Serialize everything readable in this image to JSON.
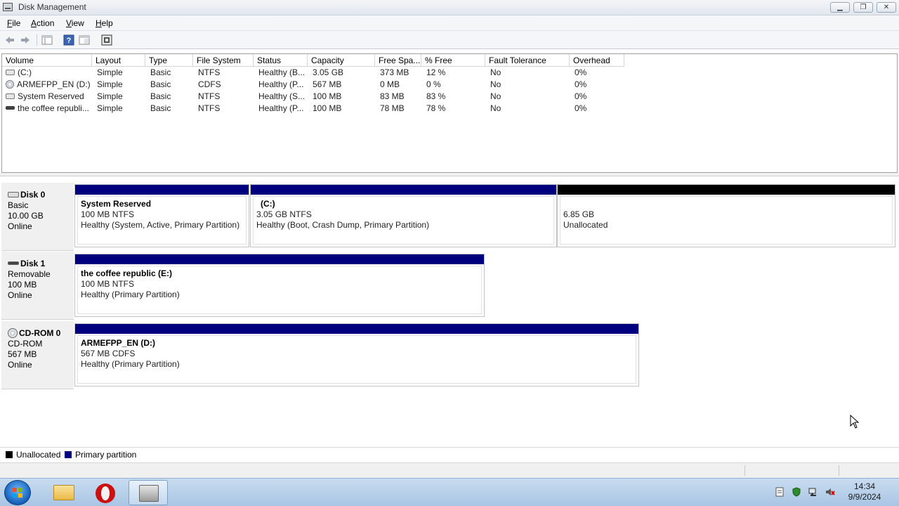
{
  "window": {
    "title": "Disk Management"
  },
  "menu": [
    {
      "label": "File",
      "mnemonic": "F",
      "rest": "ile"
    },
    {
      "label": "Action",
      "mnemonic": "A",
      "rest": "ction"
    },
    {
      "label": "View",
      "mnemonic": "V",
      "rest": "iew"
    },
    {
      "label": "Help",
      "mnemonic": "H",
      "rest": "elp"
    }
  ],
  "toolbar": {
    "icons": [
      "back-arrow-icon",
      "forward-arrow-icon",
      "show-hide-tree-icon",
      "help-icon",
      "properties-icon",
      "disk-refresh-icon"
    ]
  },
  "volume_list": {
    "columns": [
      "Volume",
      "Layout",
      "Type",
      "File System",
      "Status",
      "Capacity",
      "Free Spa...",
      "% Free",
      "Fault Tolerance",
      "Overhead"
    ],
    "rows": [
      {
        "icon": "hard-drive-icon",
        "volume": "(C:)",
        "layout": "Simple",
        "type": "Basic",
        "fs": "NTFS",
        "status": "Healthy (B...",
        "capacity": "3.05 GB",
        "free": "373 MB",
        "pct": "12 %",
        "fault": "No",
        "overhead": "0%"
      },
      {
        "icon": "cd-drive-icon",
        "volume": "ARMEFPP_EN (D:)",
        "layout": "Simple",
        "type": "Basic",
        "fs": "CDFS",
        "status": "Healthy (P...",
        "capacity": "567 MB",
        "free": "0 MB",
        "pct": "0 %",
        "fault": "No",
        "overhead": "0%"
      },
      {
        "icon": "hard-drive-icon",
        "volume": "System Reserved",
        "layout": "Simple",
        "type": "Basic",
        "fs": "NTFS",
        "status": "Healthy (S...",
        "capacity": "100 MB",
        "free": "83 MB",
        "pct": "83 %",
        "fault": "No",
        "overhead": "0%"
      },
      {
        "icon": "usb-drive-icon",
        "volume": "the coffee republi...",
        "layout": "Simple",
        "type": "Basic",
        "fs": "NTFS",
        "status": "Healthy (P...",
        "capacity": "100 MB",
        "free": "78 MB",
        "pct": "78 %",
        "fault": "No",
        "overhead": "0%"
      }
    ]
  },
  "disks": [
    {
      "name": "Disk 0",
      "kind": "Basic",
      "size": "10.00 GB",
      "state": "Online",
      "partitions": [
        {
          "title": "System Reserved",
          "line2": "100 MB NTFS",
          "line3": "Healthy (System, Active, Primary Partition)",
          "style": "primary"
        },
        {
          "title": "(C:)",
          "line2": "3.05 GB NTFS",
          "line3": "Healthy (Boot, Crash Dump, Primary Partition)",
          "style": "primary"
        },
        {
          "title": "",
          "line2": "6.85 GB",
          "line3": "Unallocated",
          "style": "unallocated"
        }
      ]
    },
    {
      "name": "Disk 1",
      "kind": "Removable",
      "size": "100 MB",
      "state": "Online",
      "partitions": [
        {
          "title": "the coffee republic  (E:)",
          "line2": "100 MB NTFS",
          "line3": "Healthy (Primary Partition)",
          "style": "primary"
        }
      ]
    },
    {
      "name": "CD-ROM 0",
      "kind": "CD-ROM",
      "size": "567 MB",
      "state": "Online",
      "partitions": [
        {
          "title": "ARMEFPP_EN  (D:)",
          "line2": "567 MB CDFS",
          "line3": "Healthy (Primary Partition)",
          "style": "primary"
        }
      ]
    }
  ],
  "legend": [
    {
      "label": "Unallocated",
      "color": "#000000"
    },
    {
      "label": "Primary partition",
      "color": "#00007f"
    }
  ],
  "taskbar": {
    "apps": [
      "windows-explorer-icon",
      "opera-browser-icon",
      "disk-management-icon"
    ],
    "tray": [
      "action-center-icon",
      "security-icon",
      "network-icon",
      "volume-muted-icon"
    ],
    "time": "14:34",
    "date": "9/9/2024"
  },
  "colors": {
    "primary": "#00007f",
    "unallocated": "#000000",
    "taskbar": "#b6cfea"
  }
}
